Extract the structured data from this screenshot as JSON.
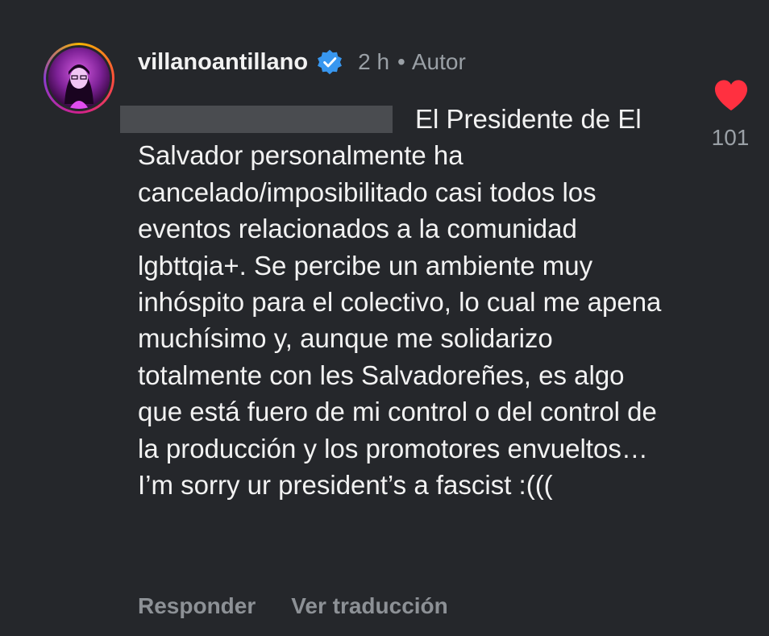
{
  "comment": {
    "username": "villanoantillano",
    "verified": true,
    "time": "2 h",
    "separator": "•",
    "author_label": "Autor",
    "mention_redacted": true,
    "text": "El Presidente de El Salvador personalmente ha cancelado/imposibilitado casi todos los eventos relacionados a la comunidad lgbttqia+. Se percibe un ambiente muy inhóspito para el colectivo, lo cual me apena muchísimo y, aunque me solidarizo totalmente con les Salvadoreñes, es algo que está fuero de mi control o del control de la producción y los promotores envueltos… I’m sorry ur president’s a fascist :((("
  },
  "like": {
    "icon": "heart-icon",
    "liked": true,
    "color": "#ff3040",
    "count": "101"
  },
  "actions": {
    "reply_label": "Responder",
    "translate_label": "Ver traducción"
  },
  "colors": {
    "background": "#25272b",
    "text_primary": "#f2f2f2",
    "text_secondary": "#9aa0a6",
    "verified_badge": "#3897f0"
  }
}
